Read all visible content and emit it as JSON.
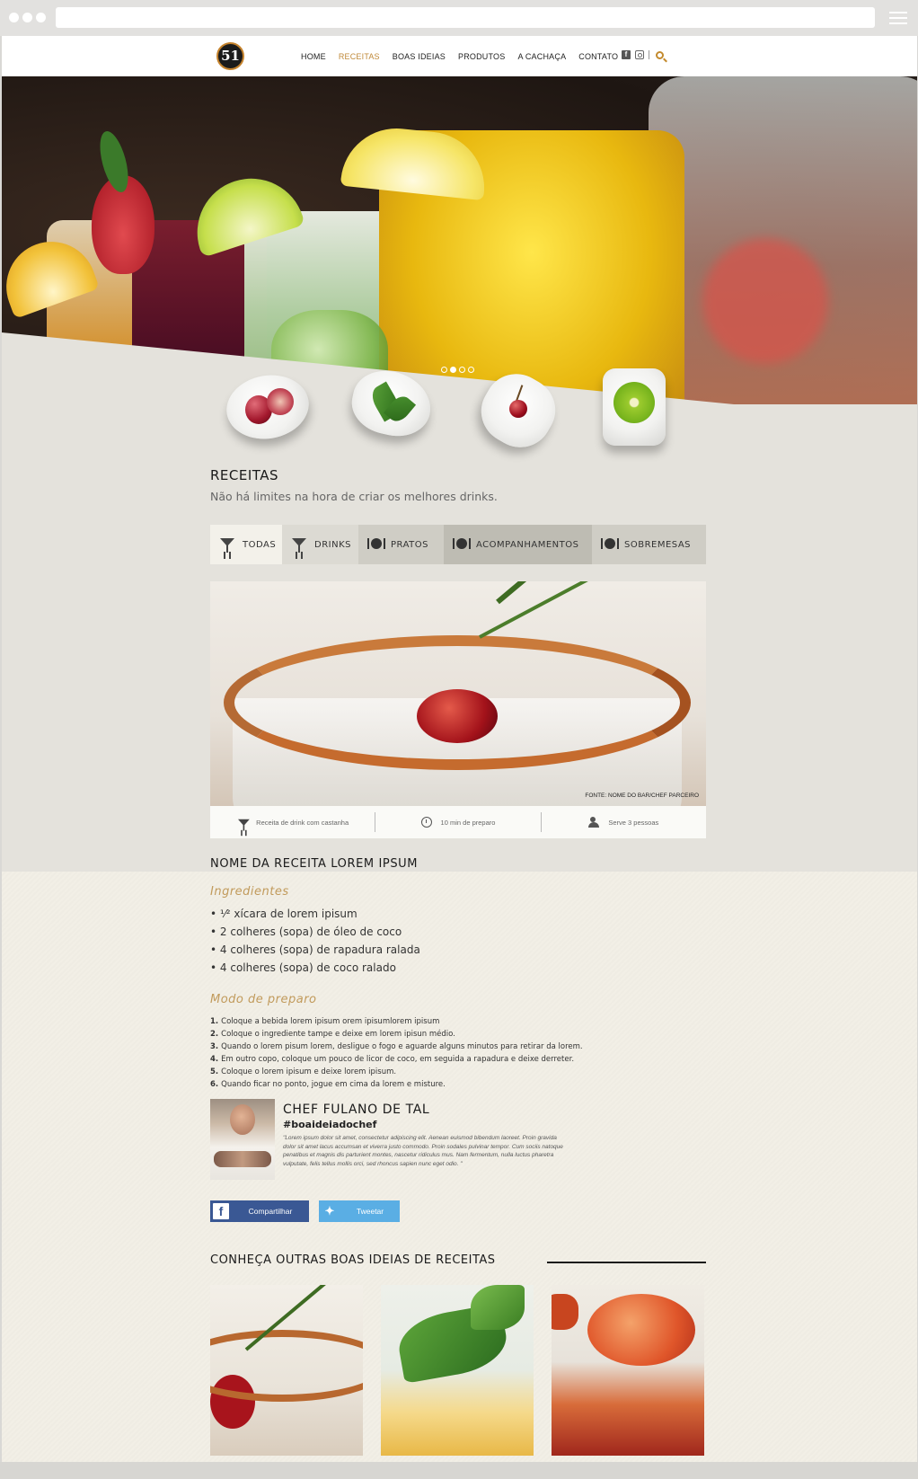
{
  "nav": {
    "logo_text": "51",
    "items": [
      {
        "label": "HOME"
      },
      {
        "label": "RECEITAS"
      },
      {
        "label": "BOAS IDEIAS"
      },
      {
        "label": "PRODUTOS"
      },
      {
        "label": "A CACHAÇA"
      },
      {
        "label": "CONTATO"
      }
    ],
    "active": "RECEITAS",
    "active_color": "#c08a3a",
    "social_icons": [
      "facebook-icon",
      "instagram-icon"
    ],
    "search_icon": "search-icon"
  },
  "hero": {
    "slides_total": 4,
    "active_slide": 2
  },
  "section": {
    "title": "RECEITAS",
    "subtitle": "Não há limites na hora de criar os melhores drinks."
  },
  "tabs": [
    {
      "label": "TODAS",
      "icon": "glass-icon"
    },
    {
      "label": "DRINKS",
      "icon": "glass-icon"
    },
    {
      "label": "PRATOS",
      "icon": "plate-icon"
    },
    {
      "label": "ACOMPANHAMENTOS",
      "icon": "plate-icon"
    },
    {
      "label": "SOBREMESAS",
      "icon": "plate-icon"
    }
  ],
  "recipe": {
    "photo_credit": "FONTE: NOME DO BAR/CHEF PARCEIRO",
    "info": {
      "type": "Receita de drink com castanha",
      "time": "10 min de preparo",
      "serves": "Serve 3 pessoas"
    },
    "name": "NOME DA RECEITA LOREM IPSUM",
    "ingredients_title": "Ingredientes",
    "ingredients": [
      "¹⁄² xícara de lorem ipisum",
      "2 colheres (sopa) de óleo de coco",
      "4 colheres (sopa) de rapadura ralada",
      "4 colheres (sopa) de coco ralado"
    ],
    "method_title": "Modo de preparo",
    "steps": [
      {
        "n": "1.",
        "text": "Coloque a bebida lorem ipisum orem ipisumlorem ipisum"
      },
      {
        "n": "2.",
        "text": "Coloque o ingrediente  tampe e deixe em lorem ipisun médio."
      },
      {
        "n": "3.",
        "text": "Quando o lorem pisum lorem, desligue o fogo e aguarde alguns minutos para retirar da lorem."
      },
      {
        "n": "4.",
        "text": "Em outro copo, coloque um pouco de licor de coco, em seguida a rapadura e deixe derreter."
      },
      {
        "n": "5.",
        "text": "Coloque o lorem ipisum  e deixe lorem ipisum."
      },
      {
        "n": "6.",
        "text": "Quando ficar no ponto, jogue em cima da lorem e misture."
      }
    ]
  },
  "chef": {
    "name": "CHEF FULANO DE TAL",
    "hashtag": "#boaideiadochef",
    "quote": "\"Lorem ipsum dolor sit amet, consectetur adipiscing elit. Aenean euismod bibendum laoreet. Proin gravida dolor sit amet lacus accumsan et viverra justo commodo. Proin sodales pulvinar tempor. Cum sociis natoque penatibus et magnis dis parturient montes, nascetur ridiculus mus. Nam fermentum, nulla luctus pharetra vulputate, felis tellus mollis orci, sed rhoncus sapien nunc eget odio. \""
  },
  "share": {
    "facebook_label": "Compartilhar",
    "twitter_label": "Tweetar",
    "facebook_color": "#3a5894",
    "twitter_color": "#5aaee4"
  },
  "more": {
    "title": "CONHEÇA OUTRAS BOAS IDEIAS DE RECEITAS"
  }
}
